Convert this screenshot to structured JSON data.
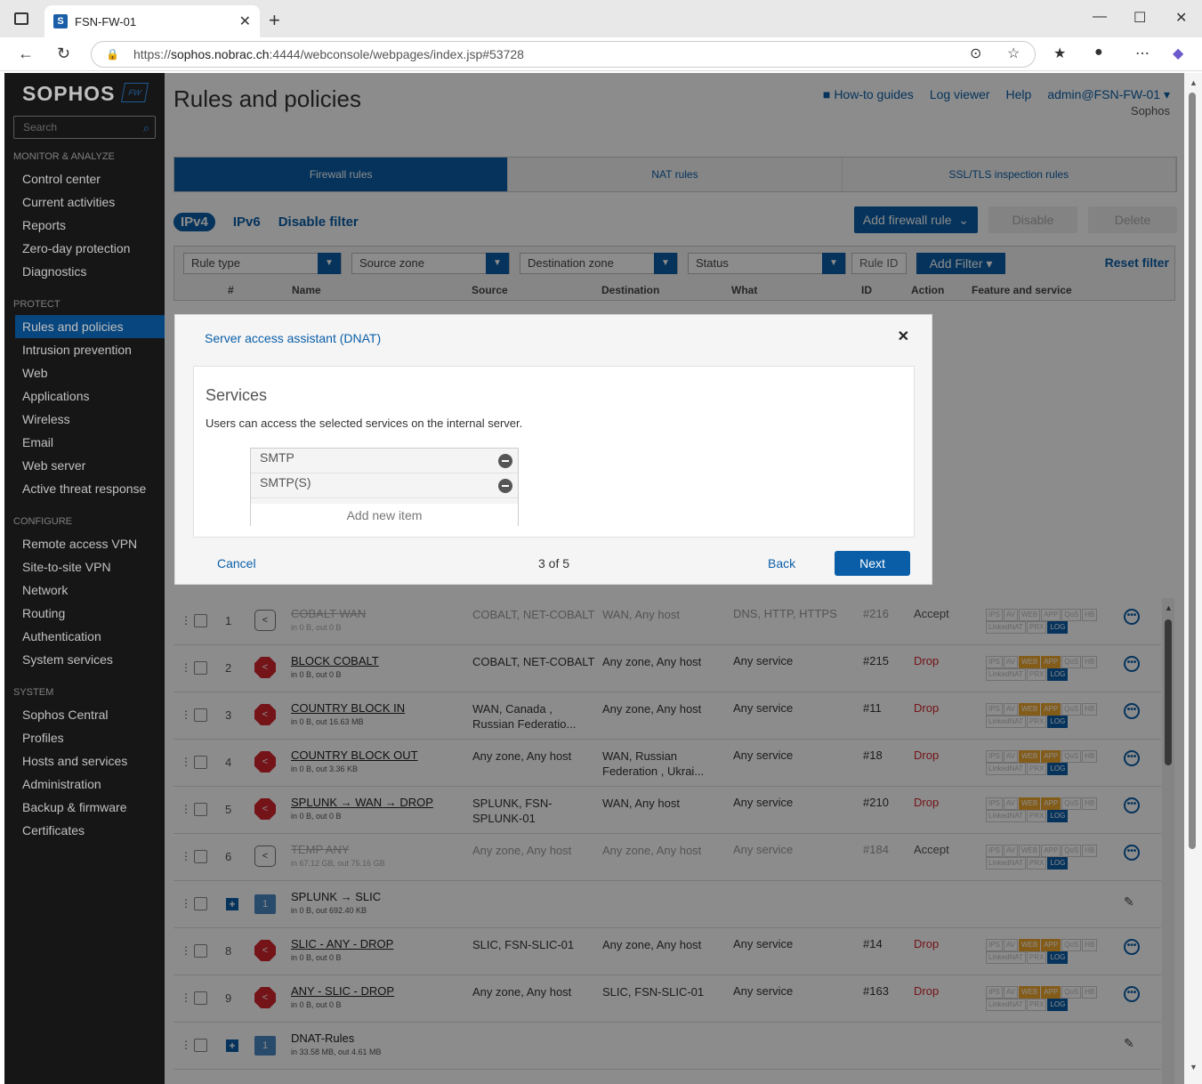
{
  "browser": {
    "tab_title": "FSN-FW-01",
    "url_prefix": "https://",
    "url_host": "sophos.nobrac.ch",
    "url_path": ":4444/webconsole/webpages/index.jsp#53728"
  },
  "sidebar": {
    "logo": "SOPHOS",
    "badge": "FW",
    "search_placeholder": "Search",
    "sections": {
      "monitor": "MONITOR & ANALYZE",
      "protect": "PROTECT",
      "configure": "CONFIGURE",
      "system": "SYSTEM"
    },
    "items": [
      "Control center",
      "Current activities",
      "Reports",
      "Zero-day protection",
      "Diagnostics",
      "Rules and policies",
      "Intrusion prevention",
      "Web",
      "Applications",
      "Wireless",
      "Email",
      "Web server",
      "Active threat response",
      "Remote access VPN",
      "Site-to-site VPN",
      "Network",
      "Routing",
      "Authentication",
      "System services",
      "Sophos Central",
      "Profiles",
      "Hosts and services",
      "Administration",
      "Backup & firmware",
      "Certificates"
    ]
  },
  "header": {
    "title": "Rules and policies",
    "howto": "How-to guides",
    "logviewer": "Log viewer",
    "help": "Help",
    "user": "admin@FSN-FW-01",
    "org": "Sophos"
  },
  "tabs": [
    "Firewall rules",
    "NAT rules",
    "SSL/TLS inspection rules"
  ],
  "filterbar": {
    "ipv4": "IPv4",
    "ipv6": "IPv6",
    "disable_filter": "Disable filter",
    "add_rule": "Add firewall rule",
    "disable": "Disable",
    "delete": "Delete",
    "rule_type": "Rule type",
    "source_zone": "Source zone",
    "destination_zone": "Destination zone",
    "status": "Status",
    "rule_id": "Rule ID",
    "add_filter": "Add Filter",
    "reset": "Reset filter"
  },
  "columns": [
    "#",
    "Name",
    "Source",
    "Destination",
    "What",
    "ID",
    "Action",
    "Feature and service"
  ],
  "rules": [
    {
      "num": "1",
      "name": "COBALT WAN",
      "traffic": "in 0 B, out 0 B",
      "source": "COBALT, NET-COBALT",
      "destination": "WAN, Any host",
      "what": "DNS, HTTP, HTTPS",
      "id": "#216",
      "action": "Accept"
    },
    {
      "num": "2",
      "name": "BLOCK COBALT",
      "traffic": "in 0 B, out 0 B",
      "source": "COBALT, NET-COBALT",
      "destination": "Any zone, Any host",
      "what": "Any service",
      "id": "#215",
      "action": "Drop"
    },
    {
      "num": "3",
      "name": "COUNTRY BLOCK IN",
      "traffic": "in 0 B, out 16.63 MB",
      "source": "WAN, Canada , Russian Federatio...",
      "destination": "Any zone, Any host",
      "what": "Any service",
      "id": "#11",
      "action": "Drop"
    },
    {
      "num": "4",
      "name": "COUNTRY BLOCK OUT",
      "traffic": "in 0 B, out 3.36 KB",
      "source": "Any zone, Any host",
      "destination": "WAN, Russian Federation , Ukrai...",
      "what": "Any service",
      "id": "#18",
      "action": "Drop"
    },
    {
      "num": "5",
      "name": "SPLUNK → WAN → DROP",
      "traffic": "in 0 B, out 0 B",
      "source": "SPLUNK, FSN-SPLUNK-01",
      "destination": "WAN, Any host",
      "what": "Any service",
      "id": "#210",
      "action": "Drop"
    },
    {
      "num": "6",
      "name": "TEMP ANY",
      "traffic": "in 67.12 GB, out 75.16 GB",
      "source": "Any zone, Any host",
      "destination": "Any zone, Any host",
      "what": "Any service",
      "id": "#184",
      "action": "Accept"
    },
    {
      "group": true,
      "name": "SPLUNK → SLIC",
      "traffic": "in 0 B, out 692.40 KB"
    },
    {
      "num": "8",
      "name": "SLIC - ANY - DROP",
      "traffic": "in 0 B, out 0 B",
      "source": "SLIC, FSN-SLIC-01",
      "destination": "Any zone, Any host",
      "what": "Any service",
      "id": "#14",
      "action": "Drop"
    },
    {
      "num": "9",
      "name": "ANY - SLIC - DROP",
      "traffic": "in 0 B, out 0 B",
      "source": "Any zone, Any host",
      "destination": "SLIC, FSN-SLIC-01",
      "what": "Any service",
      "id": "#163",
      "action": "Drop"
    },
    {
      "group": true,
      "name": "DNAT-Rules",
      "traffic": "in 33.58 MB, out 4.61 MB"
    }
  ],
  "features": {
    "line1": [
      "IPS",
      "AV",
      "WEB",
      "APP",
      "QoS",
      "HB"
    ],
    "line2": [
      "LinkedNAT",
      "PRX",
      "LOG"
    ]
  },
  "group_badge": "1",
  "modal": {
    "title": "Server access assistant (DNAT)",
    "panel_title": "Services",
    "description": "Users can access the selected services on the internal server.",
    "services": [
      "SMTP",
      "SMTP(S)"
    ],
    "add_new": "Add new item",
    "cancel": "Cancel",
    "step": "3 of 5",
    "back": "Back",
    "next": "Next"
  },
  "colors": {
    "accent": "#0a5ea8",
    "drop": "#d3262f",
    "sidebar": "#1e1e1e"
  }
}
